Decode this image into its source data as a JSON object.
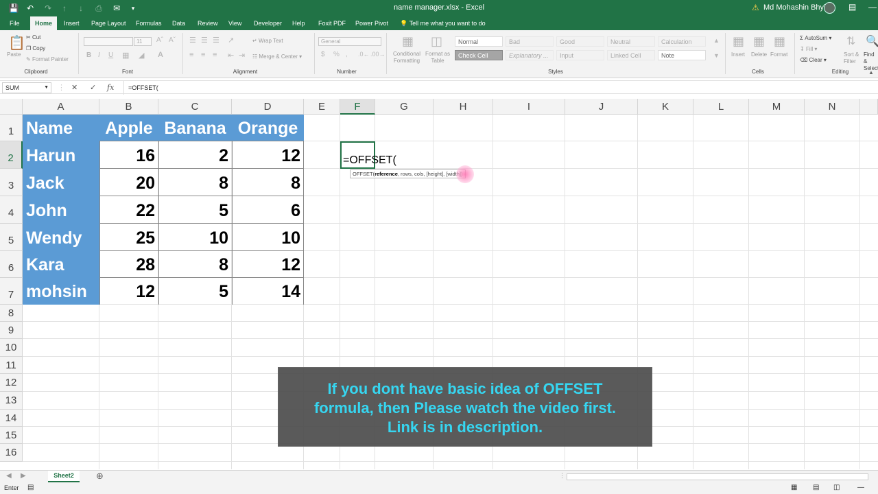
{
  "window": {
    "title": "name manager.xlsx  -  Excel",
    "user": "Md Mohashin Bhyian"
  },
  "ribbon_tabs": [
    "File",
    "Home",
    "Insert",
    "Page Layout",
    "Formulas",
    "Data",
    "Review",
    "View",
    "Developer",
    "Help",
    "Foxit PDF",
    "Power Pivot"
  ],
  "tell_me": "Tell me what you want to do",
  "ribbon": {
    "clipboard": {
      "label": "Clipboard",
      "paste": "Paste",
      "cut": "Cut",
      "copy": "Copy",
      "format_painter": "Format Painter"
    },
    "font": {
      "label": "Font",
      "font_size": "11"
    },
    "alignment": {
      "label": "Alignment",
      "wrap_text": "Wrap Text",
      "merge_center": "Merge & Center"
    },
    "number": {
      "label": "Number",
      "format": "General"
    },
    "styles": {
      "label": "Styles",
      "conditional": "Conditional Formatting",
      "format_as_table": "Format as Table",
      "cells": [
        "Normal",
        "Bad",
        "Good",
        "Neutral",
        "Calculation",
        "Check Cell",
        "Explanatory ...",
        "Input",
        "Linked Cell",
        "Note"
      ]
    },
    "cells": {
      "label": "Cells",
      "insert": "Insert",
      "delete": "Delete",
      "format": "Format"
    },
    "editing": {
      "label": "Editing",
      "autosum": "AutoSum",
      "fill": "Fill",
      "clear": "Clear",
      "sort_filter": "Sort & Filter",
      "find_select": "Find & Select"
    }
  },
  "formula_bar": {
    "name_box": "SUM",
    "formula": "=OFFSET("
  },
  "columns": [
    "A",
    "B",
    "C",
    "D",
    "E",
    "F",
    "G",
    "H",
    "I",
    "J",
    "K",
    "L",
    "M",
    "N"
  ],
  "rows": [
    "1",
    "2",
    "3",
    "4",
    "5",
    "6",
    "7",
    "8",
    "9",
    "10",
    "11",
    "12",
    "13",
    "14",
    "15",
    "16"
  ],
  "table": {
    "headers": [
      "Name",
      "Apple",
      "Banana",
      "Orange"
    ],
    "data": [
      [
        "Harun",
        "16",
        "2",
        "12"
      ],
      [
        "Jack",
        "20",
        "8",
        "8"
      ],
      [
        "John",
        "22",
        "5",
        "6"
      ],
      [
        "Wendy",
        "25",
        "10",
        "10"
      ],
      [
        "Kara",
        "28",
        "8",
        "12"
      ],
      [
        "mohsin",
        "12",
        "5",
        "14"
      ]
    ]
  },
  "active_cell": {
    "content": "=OFFSET(",
    "tooltip_func": "OFFSET(",
    "tooltip_bold": "reference",
    "tooltip_rest": ", rows, cols, [height], [width])"
  },
  "caption": {
    "lines": [
      "If you dont have basic idea of OFFSET",
      "formula, then Please watch the video first.",
      "Link is in description."
    ],
    "color": "#36d6f1"
  },
  "sheet_tabs": [
    "Sheet2"
  ],
  "status": "Enter",
  "colors": {
    "excel_green": "#217346",
    "header_fill": "#5b9bd5"
  }
}
